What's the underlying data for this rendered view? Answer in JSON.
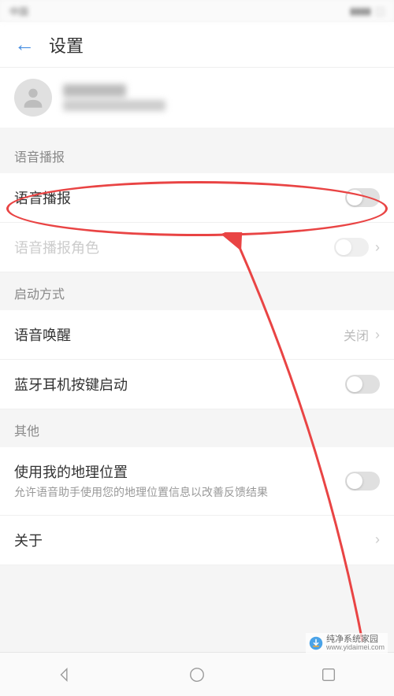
{
  "header": {
    "title": "设置"
  },
  "sections": {
    "voice": {
      "header": "语音播报",
      "broadcast": {
        "label": "语音播报"
      },
      "role": {
        "label": "语音播报角色"
      }
    },
    "startup": {
      "header": "启动方式",
      "wake": {
        "label": "语音唤醒",
        "value": "关闭"
      },
      "bluetooth": {
        "label": "蓝牙耳机按键启动"
      }
    },
    "other": {
      "header": "其他",
      "location": {
        "label": "使用我的地理位置",
        "sub": "允许语音助手使用您的地理位置信息以改善反馈结果"
      },
      "about": {
        "label": "关于"
      }
    }
  },
  "watermark": {
    "name": "纯净系统家园",
    "url": "www.yidaimei.com"
  }
}
